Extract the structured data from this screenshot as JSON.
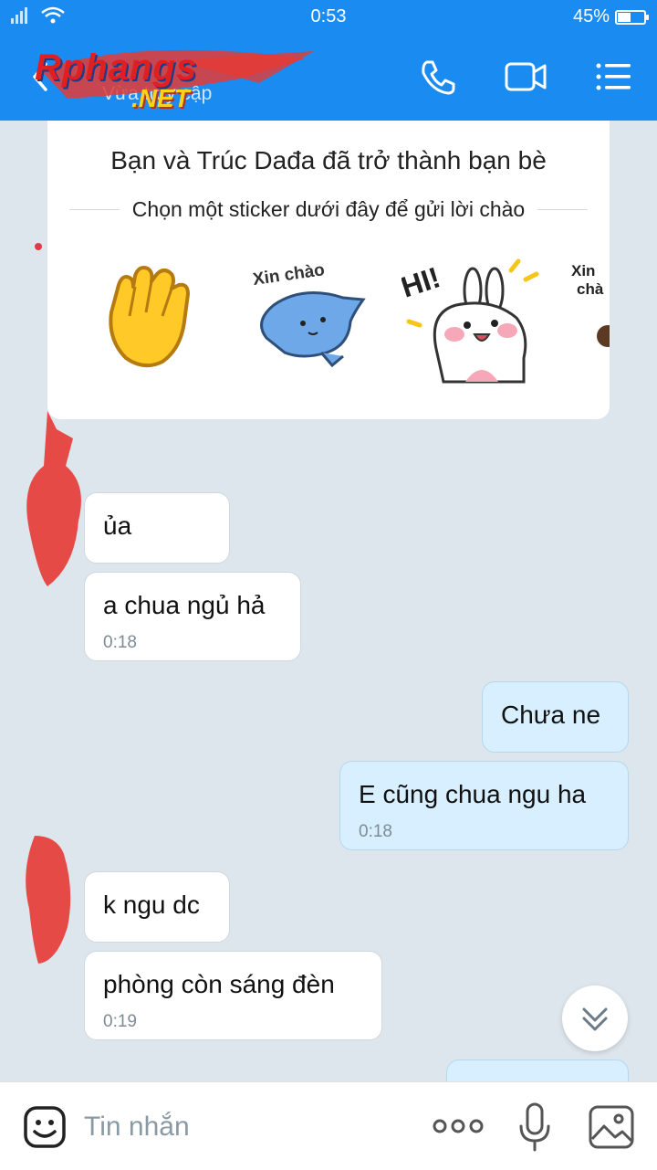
{
  "status_bar": {
    "signal": "₂⁺ᴵᴵ",
    "time": "0:53",
    "battery": "45%",
    "battery_level": 0.45
  },
  "header": {
    "subtitle": "Vừa truy cập",
    "logo_text": "Rphangs",
    "logo_suffix": ".NET",
    "icons": [
      "back-arrow-icon",
      "phone-icon",
      "video-call-icon",
      "menu-list-icon"
    ]
  },
  "greeting_card": {
    "title": "Bạn và Trúc Dađa đã trở thành bạn bè",
    "subtitle": "Chọn một sticker dưới đây để gửi lời chào",
    "stickers": [
      {
        "name": "waving-hand-sticker"
      },
      {
        "name": "xin-chao-cat-sticker",
        "text": "Xin chào"
      },
      {
        "name": "hi-bunny-sticker",
        "text": "HI!"
      },
      {
        "name": "xin-chao-sticker-partial",
        "text": "Xin chà"
      }
    ]
  },
  "messages": [
    {
      "dir": "in",
      "text": "ủa",
      "time": ""
    },
    {
      "dir": "in",
      "text": "a chua ngủ hả",
      "time": "0:18"
    },
    {
      "dir": "out",
      "text": "Chưa ne",
      "time": ""
    },
    {
      "dir": "out",
      "text": "E cũng chua ngu ha",
      "time": "0:18"
    },
    {
      "dir": "in",
      "text": "k ngu dc",
      "time": ""
    },
    {
      "dir": "in",
      "text": "phòng còn sáng đèn",
      "time": "0:19"
    }
  ],
  "input_bar": {
    "placeholder": "Tin nhắn",
    "icons": [
      "emoji-icon",
      "more-dots-icon",
      "microphone-icon",
      "image-icon"
    ]
  },
  "colors": {
    "header_bg": "#1a8bf0",
    "chat_bg": "#dde6ec",
    "incoming_bubble": "#ffffff",
    "outgoing_bubble": "#d7efff"
  }
}
